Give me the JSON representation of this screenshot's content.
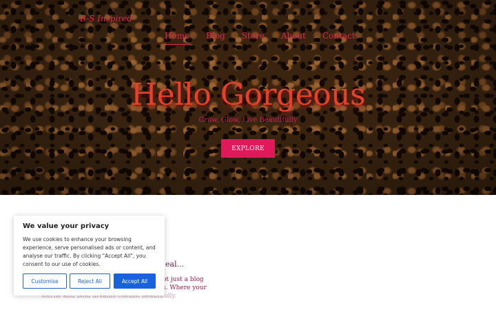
{
  "site": {
    "logo_text": "B-S Inspired"
  },
  "nav": {
    "items": [
      {
        "label": "Home",
        "active": true
      },
      {
        "label": "Blog",
        "active": false
      },
      {
        "label": "Store",
        "active": false
      },
      {
        "label": "About",
        "active": false
      },
      {
        "label": "Contact",
        "active": false
      }
    ]
  },
  "hero": {
    "headline": "Hello Gorgeous",
    "tagline": "Grow, Glow, Live Beautifully",
    "cta_label": "EXPLORE"
  },
  "content": {
    "heading_fragment": "eal...",
    "line1_fragment": "ot just a blog",
    "line2_fragment": "s. Where your",
    "line3_fragment": "sterlie and bold dreams coexist beautifully."
  },
  "cookie_banner": {
    "title": "We value your privacy",
    "text": "We use cookies to enhance your browsing experience, serve personalised ads or content, and analyse our traffic. By clicking \"Accept All\", you consent to our use of cookies.",
    "customise_label": "Customise",
    "reject_label": "Reject All",
    "accept_label": "Accept All"
  },
  "colors": {
    "accent_pink": "#e0195b",
    "headline_red": "#e2432a",
    "cookie_blue": "#1863dc"
  }
}
